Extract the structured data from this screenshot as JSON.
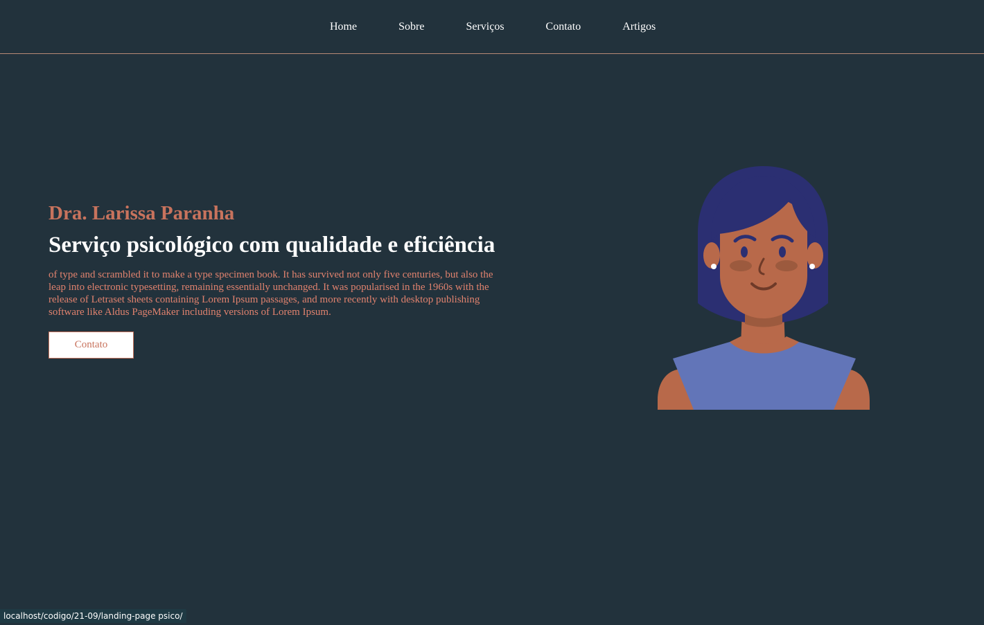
{
  "nav": {
    "items": [
      "Home",
      "Sobre",
      "Serviços",
      "Contato",
      "Artigos"
    ]
  },
  "hero": {
    "name": "Dra. Larissa Paranha",
    "title": "Serviço psicológico com qualidade e eficiência",
    "description": "of type and scrambled it to make a type specimen book. It has survived not only five centuries, but also the leap into electronic typesetting, remaining essentially unchanged. It was popularised in the 1960s with the release of Letraset sheets containing Lorem Ipsum passages, and more recently with desktop publishing software like Aldus PageMaker including versions of Lorem Ipsum.",
    "button_label": "Contato"
  },
  "status_bar": {
    "url": "localhost/codigo/21-09/landing-page psico/"
  },
  "colors": {
    "background": "#22323c",
    "accent": "#c8735d",
    "nav_border": "#b88a76",
    "hair": "#2b2f72",
    "skin": "#b8694a",
    "shirt": "#6275b8"
  },
  "illustration": {
    "icon": "woman-avatar-icon"
  }
}
